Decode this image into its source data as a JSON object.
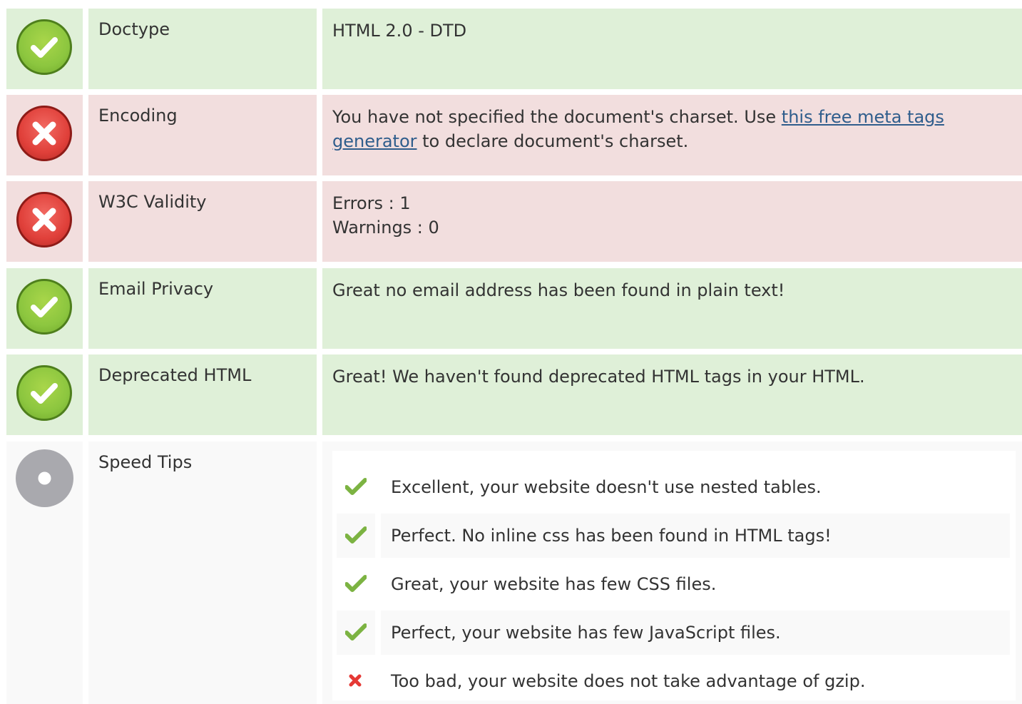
{
  "rows": [
    {
      "status": "ok",
      "icon": "check-circle-icon",
      "label": "Doctype",
      "value_lines": [
        "HTML 2.0 - DTD"
      ]
    },
    {
      "status": "bad",
      "icon": "cross-circle-icon",
      "label": "Encoding",
      "value_before": "You have not specified the document's charset. Use ",
      "value_link": "this free meta tags generator",
      "value_after": " to declare document's charset."
    },
    {
      "status": "bad",
      "icon": "cross-circle-icon",
      "label": "W3C Validity",
      "value_lines": [
        "Errors : 1",
        "Warnings : 0"
      ]
    },
    {
      "status": "ok",
      "icon": "check-circle-icon",
      "label": "Email Privacy",
      "value_lines": [
        "Great no email address has been found in plain text!"
      ]
    },
    {
      "status": "ok",
      "icon": "check-circle-icon",
      "label": "Deprecated HTML",
      "value_lines": [
        "Great! We haven't found deprecated HTML tags in your HTML."
      ]
    },
    {
      "status": "info",
      "icon": "neutral-circle-icon",
      "label": "Speed Tips"
    }
  ],
  "speed_tips": [
    {
      "result": "pass",
      "icon": "checkmark-icon",
      "text": "Excellent, your website doesn't use nested tables."
    },
    {
      "result": "pass",
      "icon": "checkmark-icon",
      "text": "Perfect. No inline css has been found in HTML tags!"
    },
    {
      "result": "pass",
      "icon": "checkmark-icon",
      "text": "Great, your website has few CSS files."
    },
    {
      "result": "pass",
      "icon": "checkmark-icon",
      "text": "Perfect, your website has few JavaScript files."
    },
    {
      "result": "fail",
      "icon": "cross-mark-icon",
      "text": "Too bad, your website does not take advantage of gzip."
    }
  ],
  "colors": {
    "ok_bg": "#dff0d8",
    "bad_bg": "#f2dede",
    "info_bg": "#f9f9f9",
    "pass_mark": "#7cb342",
    "fail_mark": "#e53935",
    "link": "#2f5d8c"
  }
}
